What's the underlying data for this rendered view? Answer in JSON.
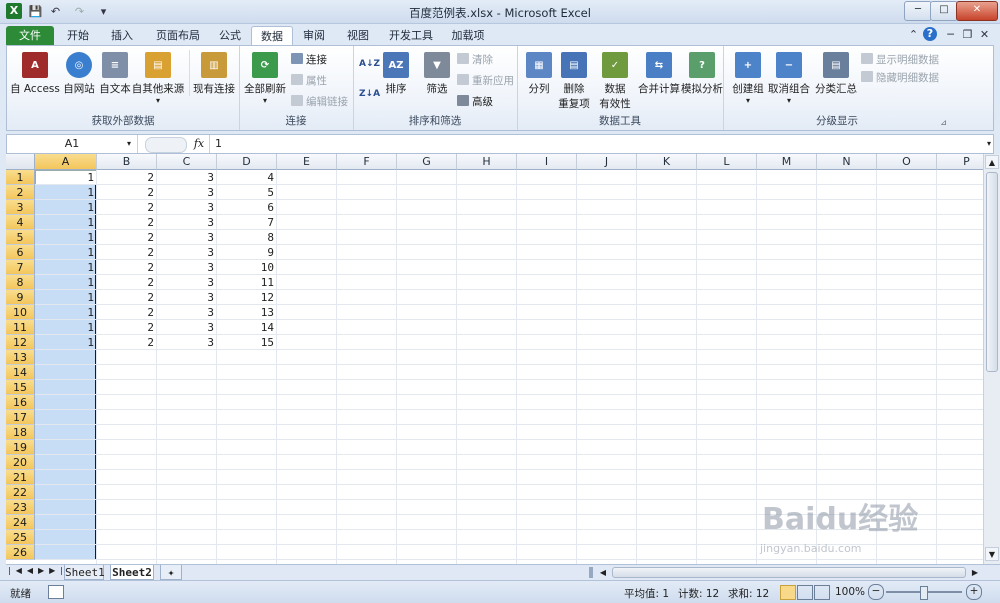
{
  "window": {
    "title": "百度范例表.xlsx - Microsoft Excel",
    "app_letter": "X",
    "minimize": "─",
    "maximize": "□",
    "close": "✕"
  },
  "tabs": [
    {
      "label": "文件",
      "id": "file"
    },
    {
      "label": "开始",
      "id": "home"
    },
    {
      "label": "插入",
      "id": "insert"
    },
    {
      "label": "页面布局",
      "id": "layout"
    },
    {
      "label": "公式",
      "id": "formulas"
    },
    {
      "label": "数据",
      "id": "data",
      "active": true
    },
    {
      "label": "审阅",
      "id": "review"
    },
    {
      "label": "视图",
      "id": "view"
    },
    {
      "label": "开发工具",
      "id": "developer"
    },
    {
      "label": "加载项",
      "id": "addins"
    }
  ],
  "ribbon": {
    "external": {
      "label": "获取外部数据",
      "access": "自 Access",
      "web": "自网站",
      "text": "自文本",
      "other": "自其他来源",
      "existing": "现有连接"
    },
    "connections": {
      "label": "连接",
      "refresh": "全部刷新",
      "connect": "连接",
      "properties": "属性",
      "editlinks": "编辑链接"
    },
    "sortfilter": {
      "label": "排序和筛选",
      "sort": "排序",
      "filter": "筛选",
      "clear": "清除",
      "reapply": "重新应用",
      "advanced": "高级",
      "az": "A↓Z",
      "za": "Z↓A"
    },
    "datatools": {
      "label": "数据工具",
      "split": "分列",
      "removedup1": "删除",
      "removedup2": "重复项",
      "validation1": "数据",
      "validation2": "有效性",
      "consolidate": "合并计算",
      "whatif": "模拟分析"
    },
    "outline": {
      "label": "分级显示",
      "group": "创建组",
      "ungroup": "取消组合",
      "subtotal": "分类汇总",
      "showdetail": "显示明细数据",
      "hidedetail": "隐藏明细数据"
    }
  },
  "formula": {
    "namebox": "A1",
    "fx": "fx",
    "value": "1"
  },
  "grid": {
    "columns": [
      "A",
      "B",
      "C",
      "D",
      "E",
      "F",
      "G",
      "H",
      "I",
      "J",
      "K",
      "L",
      "M",
      "N",
      "O",
      "P"
    ],
    "rows": [
      "1",
      "2",
      "3",
      "4",
      "5",
      "6",
      "7",
      "8",
      "9",
      "10",
      "11",
      "12",
      "13",
      "14",
      "15",
      "16",
      "17",
      "18",
      "19",
      "20",
      "21",
      "22",
      "23",
      "24",
      "25",
      "26"
    ],
    "values": [
      [
        "1",
        "2",
        "3",
        "4"
      ],
      [
        "1",
        "2",
        "3",
        "5"
      ],
      [
        "1",
        "2",
        "3",
        "6"
      ],
      [
        "1",
        "2",
        "3",
        "7"
      ],
      [
        "1",
        "2",
        "3",
        "8"
      ],
      [
        "1",
        "2",
        "3",
        "9"
      ],
      [
        "1",
        "2",
        "3",
        "10"
      ],
      [
        "1",
        "2",
        "3",
        "11"
      ],
      [
        "1",
        "2",
        "3",
        "12"
      ],
      [
        "1",
        "2",
        "3",
        "13"
      ],
      [
        "1",
        "2",
        "3",
        "14"
      ],
      [
        "1",
        "2",
        "3",
        "15"
      ]
    ],
    "selected_column": "A"
  },
  "sheets": [
    {
      "label": "Sheet1"
    },
    {
      "label": "Sheet2",
      "active": true
    }
  ],
  "status": {
    "ready": "就绪",
    "average": "平均值: 1",
    "count": "计数: 12",
    "sum": "求和: 12",
    "zoom": "100%",
    "minus": "−",
    "plus": "+"
  },
  "watermark": "Baidu经验",
  "watermark_sub": "jingyan.baidu.com",
  "colors": {
    "accent": "#2d8a37",
    "selection": "#c7dcf5",
    "header_sel": "#f3c65c"
  }
}
